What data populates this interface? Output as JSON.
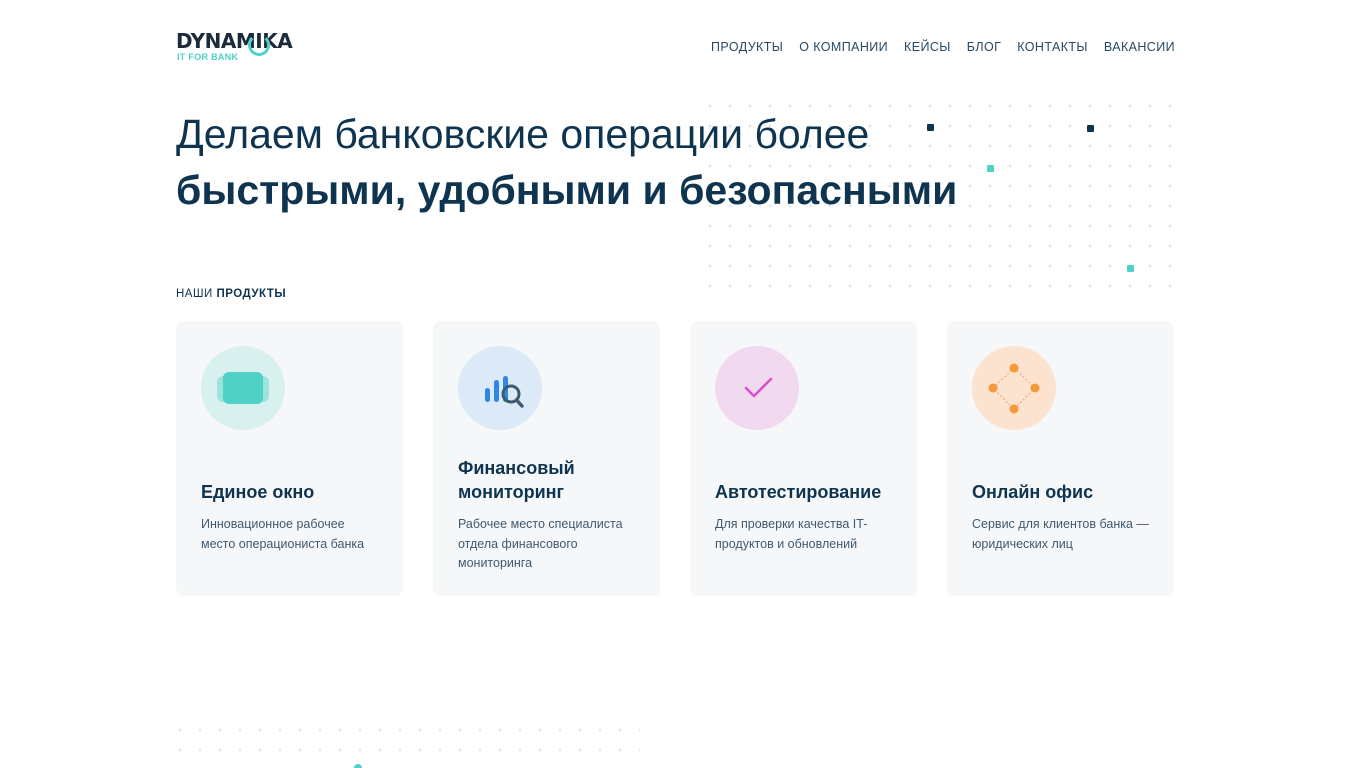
{
  "brand": {
    "name": "DYNAMIKA",
    "tagline": "IT FOR BANK",
    "accent_color": "#4fd1c5",
    "text_color": "#0e3450"
  },
  "nav": {
    "items": [
      {
        "label": "ПРОДУКТЫ"
      },
      {
        "label": "О КОМПАНИИ"
      },
      {
        "label": "КЕЙСЫ"
      },
      {
        "label": "БЛОГ"
      },
      {
        "label": "КОНТАКТЫ"
      },
      {
        "label": "ВАКАНСИИ"
      }
    ]
  },
  "hero": {
    "line1": "Делаем банковские операции более",
    "line2": "быстрыми, удобными и безопасными"
  },
  "products_section": {
    "label_prefix": "НАШИ ",
    "label_bold": "ПРОДУКТЫ"
  },
  "cards": [
    {
      "title": "Единое окно",
      "desc": "Инновационное рабочее место операциониста банка",
      "icon": "window-cards-icon",
      "icon_bg": "#d9f1ee"
    },
    {
      "title": "Финансовый мониторинг",
      "desc": "Рабочее место специалиста отдела финансового мониторинга",
      "icon": "chart-search-icon",
      "icon_bg": "#dceaf8"
    },
    {
      "title": "Автотестирование",
      "desc": "Для проверки качества IT-продуктов и обновлений",
      "icon": "checkmark-icon",
      "icon_bg": "#f1d9f0"
    },
    {
      "title": "Онлайн офис",
      "desc": "Сервис для клиентов банка — юридических лиц",
      "icon": "network-nodes-icon",
      "icon_bg": "#fbe3cf"
    }
  ]
}
